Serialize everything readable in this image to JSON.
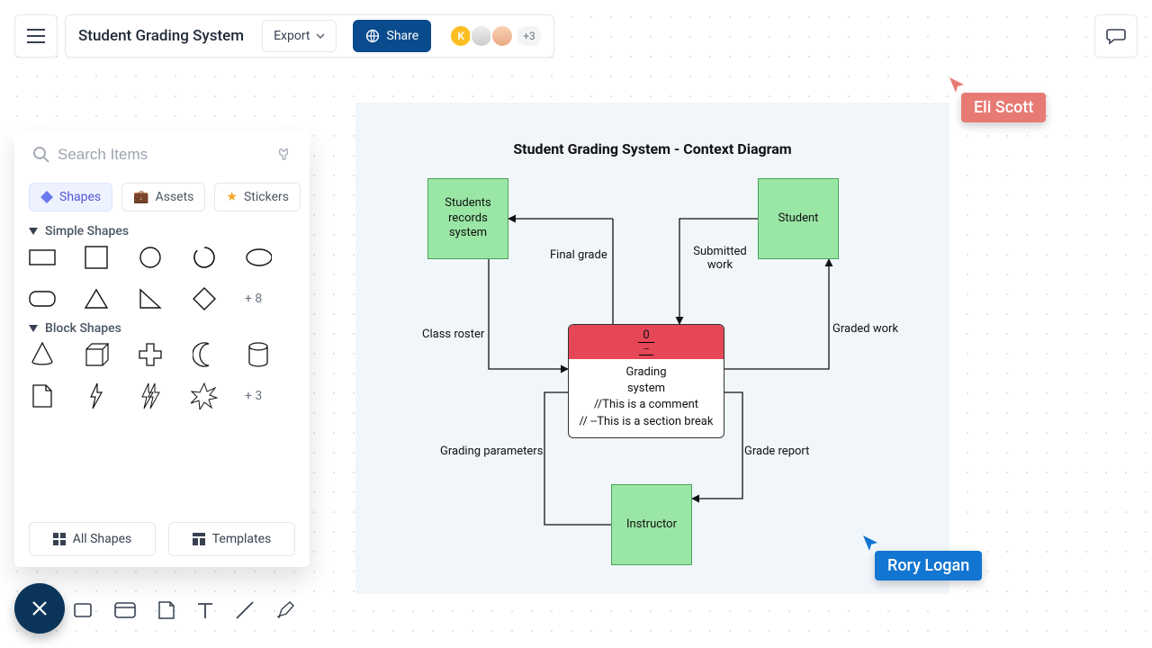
{
  "header": {
    "doc_title": "Student Grading System",
    "export_label": "Export",
    "share_label": "Share",
    "avatars": {
      "initial": "K",
      "more_count": "+3"
    }
  },
  "panel": {
    "search_placeholder": "Search Items",
    "tabs": {
      "shapes": "Shapes",
      "assets": "Assets",
      "stickers": "Stickers"
    },
    "sections": {
      "simple": {
        "title": "Simple Shapes",
        "more": "+ 8"
      },
      "block": {
        "title": "Block Shapes",
        "more": "+ 3"
      }
    },
    "footer": {
      "all_shapes": "All Shapes",
      "templates": "Templates"
    }
  },
  "diagram": {
    "title": "Student Grading System - Context Diagram",
    "nodes": {
      "records": "Students records system",
      "student": "Student",
      "instructor": "Instructor"
    },
    "process": {
      "id": "0",
      "dashes": "--",
      "name1": "Grading",
      "name2": "system",
      "comment": "//This is a comment",
      "section": "// --This is a section break"
    },
    "edges": {
      "final_grade": "Final grade",
      "class_roster": "Class roster",
      "submitted_work": "Submitted work",
      "graded_work": "Graded work",
      "grading_parameters": "Grading parameters",
      "grade_report": "Grade report"
    }
  },
  "cursors": {
    "eli": {
      "name": "Eli Scott",
      "color": "#e87a74"
    },
    "rory": {
      "name": "Rory Logan",
      "color": "#1275d1"
    }
  }
}
